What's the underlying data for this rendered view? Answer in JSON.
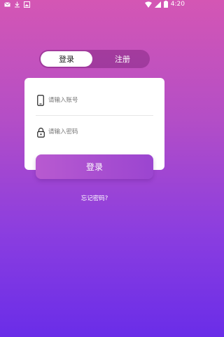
{
  "status_bar": {
    "time": "4:20",
    "left_icons": [
      "mail-icon",
      "download-icon",
      "image-icon"
    ],
    "right_icons": [
      "wifi-icon",
      "signal-icon",
      "battery-icon"
    ]
  },
  "tabs": {
    "login": "登录",
    "register": "注册"
  },
  "form": {
    "account_placeholder": "请输入账号",
    "password_placeholder": "请输入密码",
    "account_icon": "phone-icon",
    "password_icon": "lock-icon"
  },
  "login_button": "登录",
  "forgot_password": "忘记密码?",
  "colors": {
    "gradient_top": "#d456b4",
    "gradient_bottom": "#6a2de8",
    "button": "#a94fd0"
  }
}
